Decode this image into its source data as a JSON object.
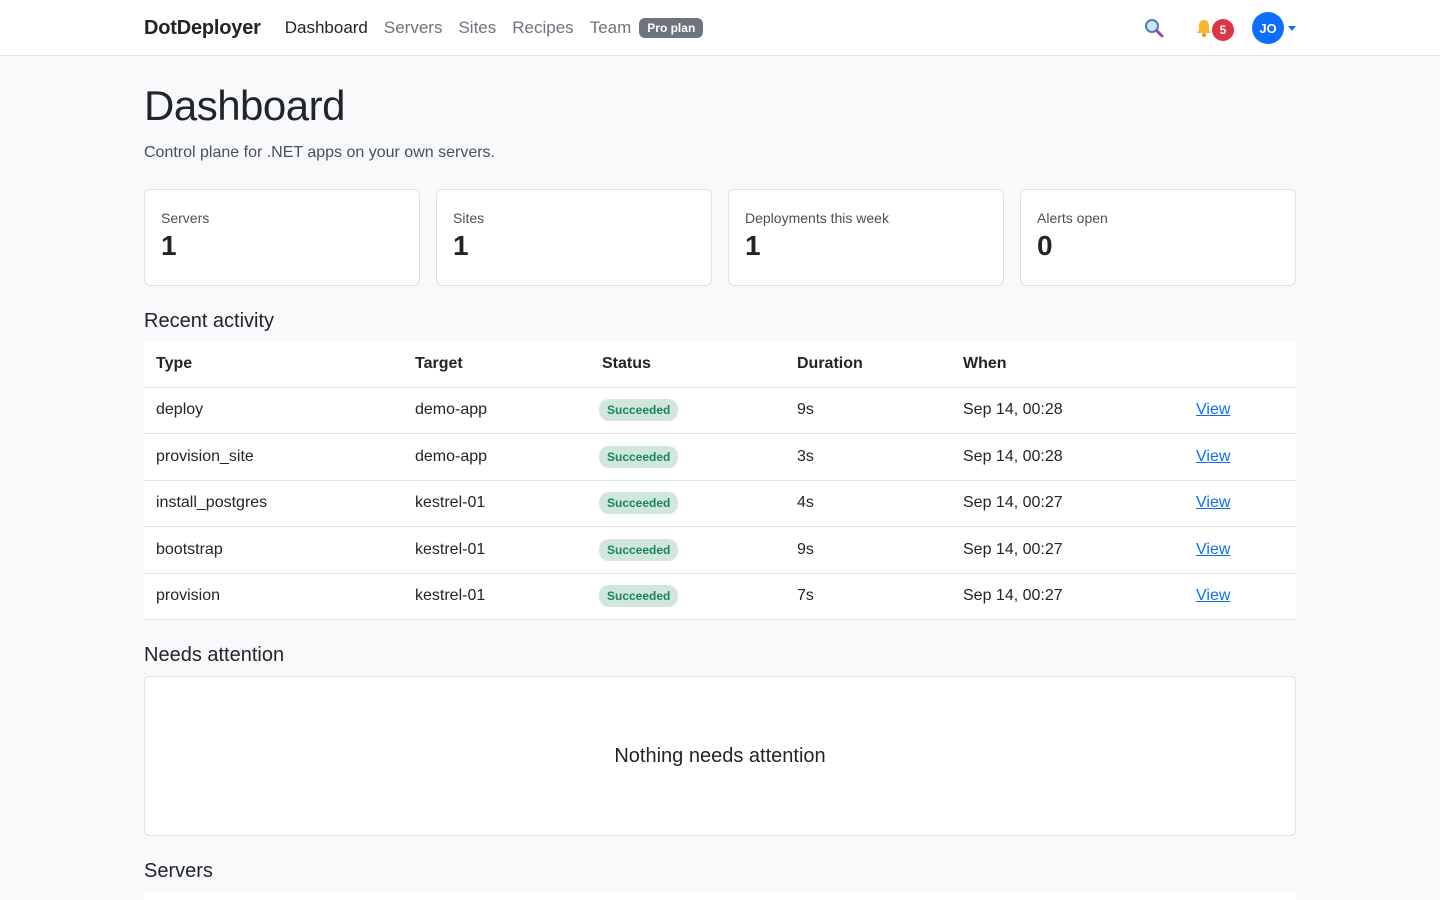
{
  "nav": {
    "brand": "DotDeployer",
    "links": [
      "Dashboard",
      "Servers",
      "Sites",
      "Recipes",
      "Team"
    ],
    "plan_badge": "Pro plan",
    "notification_count": "5",
    "avatar_initials": "JO"
  },
  "page": {
    "title": "Dashboard",
    "subtitle": "Control plane for .NET apps on your own servers."
  },
  "stats": [
    {
      "label": "Servers",
      "value": "1"
    },
    {
      "label": "Sites",
      "value": "1"
    },
    {
      "label": "Deployments this week",
      "value": "1"
    },
    {
      "label": "Alerts open",
      "value": "0"
    }
  ],
  "activity": {
    "title": "Recent activity",
    "headers": [
      "Type",
      "Target",
      "Status",
      "Duration",
      "When",
      ""
    ],
    "rows": [
      {
        "type": "deploy",
        "target": "demo-app",
        "status": "Succeeded",
        "duration": "9s",
        "when": "Sep 14, 00:28",
        "action": "View"
      },
      {
        "type": "provision_site",
        "target": "demo-app",
        "status": "Succeeded",
        "duration": "3s",
        "when": "Sep 14, 00:28",
        "action": "View"
      },
      {
        "type": "install_postgres",
        "target": "kestrel-01",
        "status": "Succeeded",
        "duration": "4s",
        "when": "Sep 14, 00:27",
        "action": "View"
      },
      {
        "type": "bootstrap",
        "target": "kestrel-01",
        "status": "Succeeded",
        "duration": "9s",
        "when": "Sep 14, 00:27",
        "action": "View"
      },
      {
        "type": "provision",
        "target": "kestrel-01",
        "status": "Succeeded",
        "duration": "7s",
        "when": "Sep 14, 00:27",
        "action": "View"
      }
    ]
  },
  "attention": {
    "title": "Needs attention",
    "empty_text": "Nothing needs attention"
  },
  "servers_section": {
    "title": "Servers"
  },
  "colors": {
    "accent": "#0d6efd",
    "success_bg": "#d1e7dd",
    "success_text": "#198754",
    "danger": "#dc3545"
  }
}
